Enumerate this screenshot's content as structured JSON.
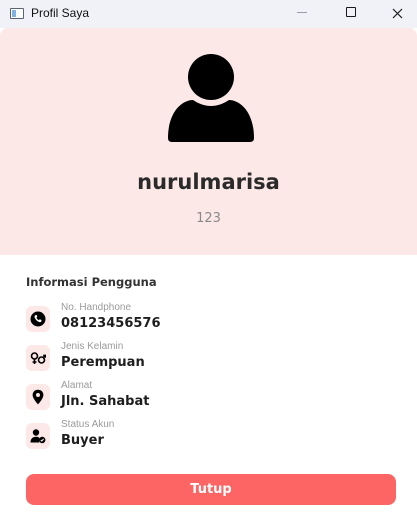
{
  "window": {
    "title": "Profil Saya",
    "icon": "app-window-icon",
    "controls": [
      "minimize-icon",
      "maximize-icon",
      "close-icon"
    ]
  },
  "profile": {
    "avatar_icon": "user-avatar-icon",
    "username": "nurulmarisa",
    "user_id": "123"
  },
  "info": {
    "section_title": "Informasi Pengguna",
    "items": [
      {
        "icon": "phone-icon",
        "label": "No. Handphone",
        "value": "08123456576"
      },
      {
        "icon": "gender-icon",
        "label": "Jenis Kelamin",
        "value": "Perempuan"
      },
      {
        "icon": "location-pin-icon",
        "label": "Alamat",
        "value": "Jln. Sahabat"
      },
      {
        "icon": "user-status-icon",
        "label": "Status Akun",
        "value": "Buyer"
      }
    ]
  },
  "actions": {
    "close_label": "Tutup"
  },
  "colors": {
    "header_bg": "#fde8e8",
    "icon_bg": "#fde8e8",
    "button_bg": "#fd6464",
    "button_text": "#ffffff",
    "titlebar_bg": "#f0f2f7"
  }
}
